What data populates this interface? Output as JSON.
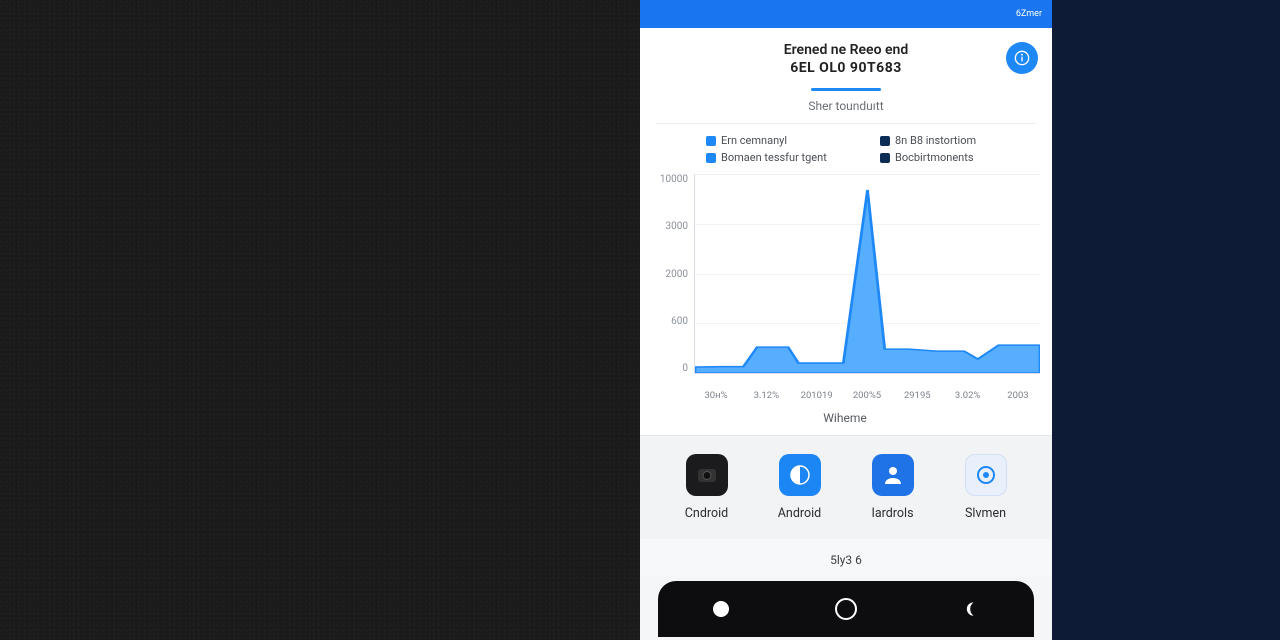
{
  "topbar": {
    "status_text": "6Zmer"
  },
  "header": {
    "title": "Erened ne Reeo end",
    "subtitle": "6EL OL0 90T683"
  },
  "action_button": {
    "name": "info"
  },
  "tab": {
    "label": "Sher tounduıtt"
  },
  "legend": [
    {
      "label": "Ern cemnanyl",
      "color": "#1e88f7"
    },
    {
      "label": "8n B8 instortiom",
      "color": "#0b2d55"
    },
    {
      "label": "Bomaen tеssfur tgent",
      "color": "#1e88f7"
    },
    {
      "label": "Bocbirtmonents",
      "color": "#0b2d55"
    }
  ],
  "chart_data": {
    "type": "area",
    "title": "",
    "xlabel": "Wiheme",
    "ylabel": "",
    "ylim": [
      0,
      10000
    ],
    "yticks": [
      10000,
      3000,
      2000,
      600,
      0
    ],
    "categories": [
      "30н%",
      "3.12%",
      "201019",
      "200%5",
      "29195",
      "3.02%",
      "2003"
    ],
    "series": [
      {
        "name": "Ern cemnanyl",
        "values": [
          300,
          320,
          1300,
          500,
          9200,
          1200,
          1100
        ]
      }
    ]
  },
  "apps": {
    "items": [
      {
        "label": "Cndroid",
        "icon": "camera-icon"
      },
      {
        "label": "Android",
        "icon": "globe-icon"
      },
      {
        "label": "Iardrols",
        "icon": "person-icon"
      },
      {
        "label": "Slvmen",
        "icon": "target-icon"
      }
    ]
  },
  "system": {
    "label": "5ly3 6"
  },
  "nav": {
    "buttons": [
      "back",
      "home",
      "recent"
    ]
  }
}
